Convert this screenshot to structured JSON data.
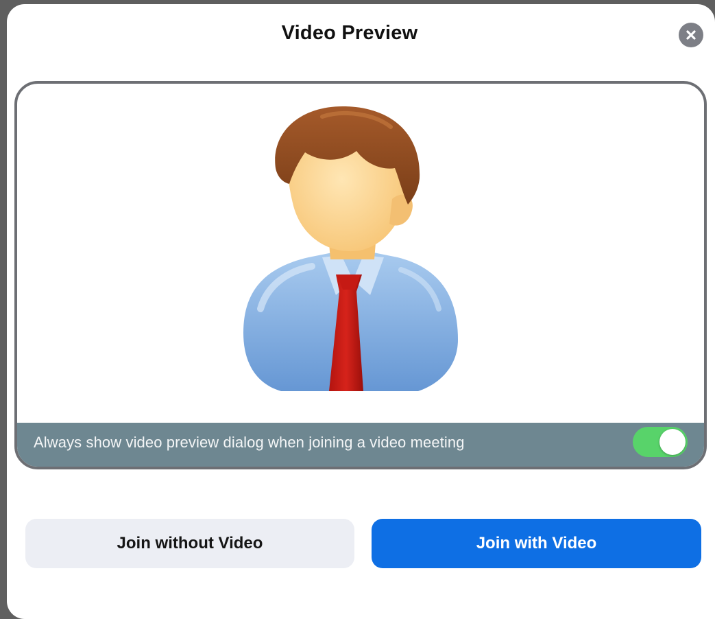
{
  "dialog": {
    "title": "Video Preview",
    "close_icon": "close-icon"
  },
  "preview": {
    "avatar_icon": "person-avatar",
    "always_show_label": "Always show video preview dialog when joining a video meeting",
    "always_show_enabled": true
  },
  "buttons": {
    "join_without_video": "Join without Video",
    "join_with_video": "Join with Video"
  },
  "colors": {
    "primary": "#0e6fe4",
    "toggle_on": "#58d36a",
    "secondary_button": "#eceef4"
  }
}
